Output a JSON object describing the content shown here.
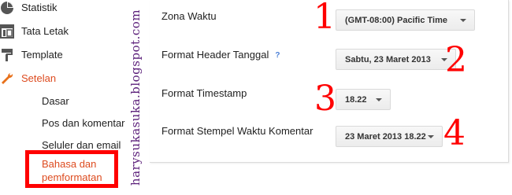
{
  "sidebar": {
    "items": [
      {
        "label": "Statistik",
        "icon": "pie-chart-icon"
      },
      {
        "label": "Tata Letak",
        "icon": "layout-icon"
      },
      {
        "label": "Template",
        "icon": "paint-roller-icon"
      },
      {
        "label": "Setelan",
        "icon": "wrench-icon"
      }
    ],
    "subitems": [
      "Dasar",
      "Pos dan komentar",
      "Seluler dan email"
    ],
    "active_subitem": [
      "Bahasa dan",
      "pemformatan"
    ]
  },
  "watermark": "harysukasuka.blogspot.com",
  "settings": {
    "rows": [
      {
        "label": "Zona Waktu",
        "value": "(GMT-08:00) Pacific Time",
        "marker": "1"
      },
      {
        "label": "Format Header Tanggal",
        "help": "?",
        "value": "Sabtu, 23 Maret 2013",
        "marker": "2"
      },
      {
        "label": "Format Timestamp",
        "value": "18.22",
        "marker": "3"
      },
      {
        "label": "Format Stempel Waktu Komentar",
        "value": "23 Maret 2013 18.22",
        "marker": "4"
      }
    ]
  },
  "colors": {
    "accent": "#dd4b1f",
    "annotation": "#ff0000",
    "watermark": "#5b1f7a"
  }
}
